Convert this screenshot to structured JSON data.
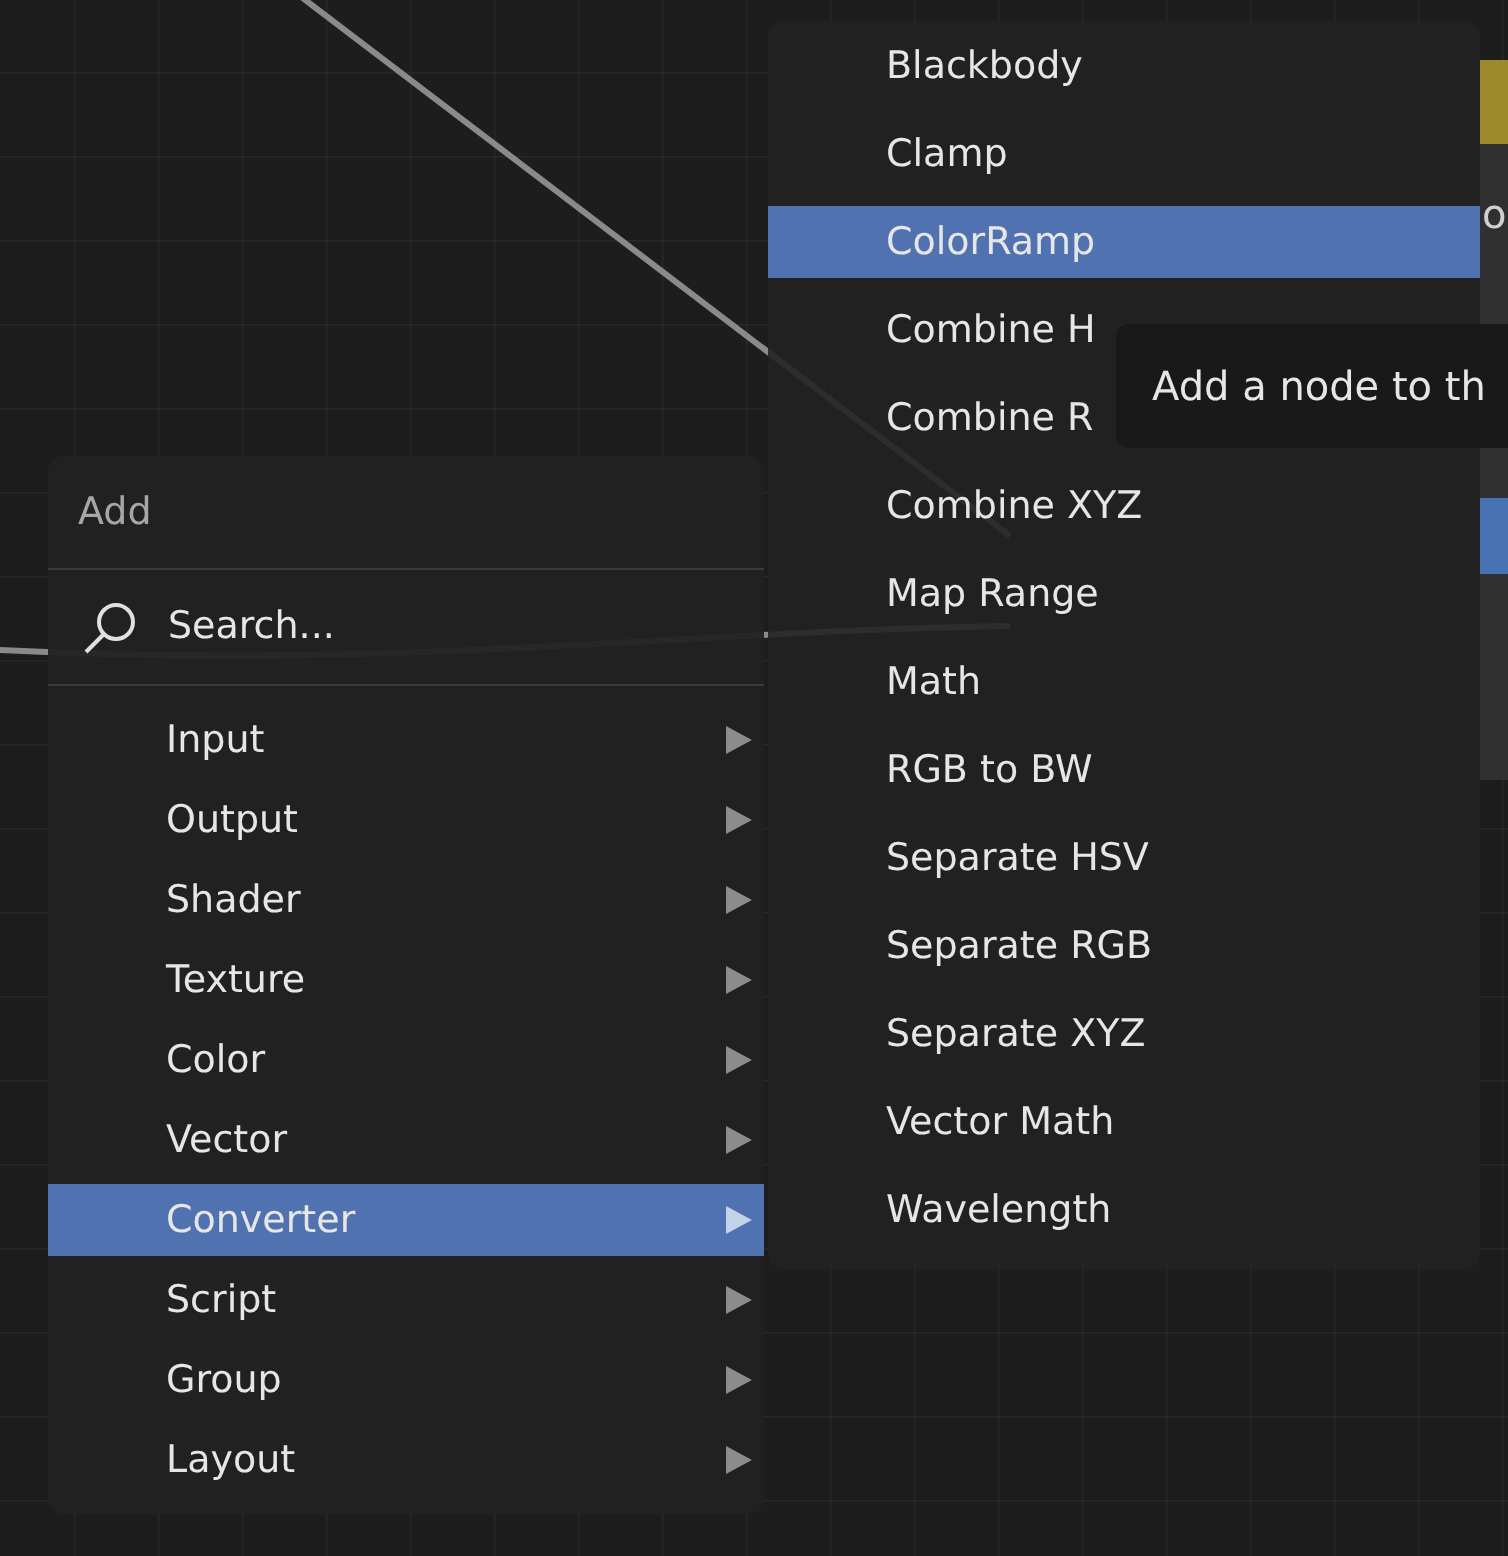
{
  "node": {
    "output": "o"
  },
  "menu": {
    "title": "Add",
    "search": {
      "label": "Search..."
    },
    "items": [
      {
        "label": "Input",
        "selected": false
      },
      {
        "label": "Output",
        "selected": false
      },
      {
        "label": "Shader",
        "selected": false
      },
      {
        "label": "Texture",
        "selected": false
      },
      {
        "label": "Color",
        "selected": false
      },
      {
        "label": "Vector",
        "selected": false
      },
      {
        "label": "Converter",
        "selected": true
      },
      {
        "label": "Script",
        "selected": false
      },
      {
        "label": "Group",
        "selected": false
      },
      {
        "label": "Layout",
        "selected": false
      }
    ]
  },
  "submenu": {
    "items": [
      {
        "label": "Blackbody",
        "selected": false
      },
      {
        "label": "Clamp",
        "selected": false
      },
      {
        "label": "ColorRamp",
        "selected": true
      },
      {
        "label": "Combine H",
        "selected": false
      },
      {
        "label": "Combine R",
        "selected": false
      },
      {
        "label": "Combine XYZ",
        "selected": false
      },
      {
        "label": "Map Range",
        "selected": false
      },
      {
        "label": "Math",
        "selected": false
      },
      {
        "label": "RGB to BW",
        "selected": false
      },
      {
        "label": "Separate HSV",
        "selected": false
      },
      {
        "label": "Separate RGB",
        "selected": false
      },
      {
        "label": "Separate XYZ",
        "selected": false
      },
      {
        "label": "Vector Math",
        "selected": false
      },
      {
        "label": "Wavelength",
        "selected": false
      }
    ]
  },
  "tooltip": {
    "text": "Add a node to th"
  }
}
